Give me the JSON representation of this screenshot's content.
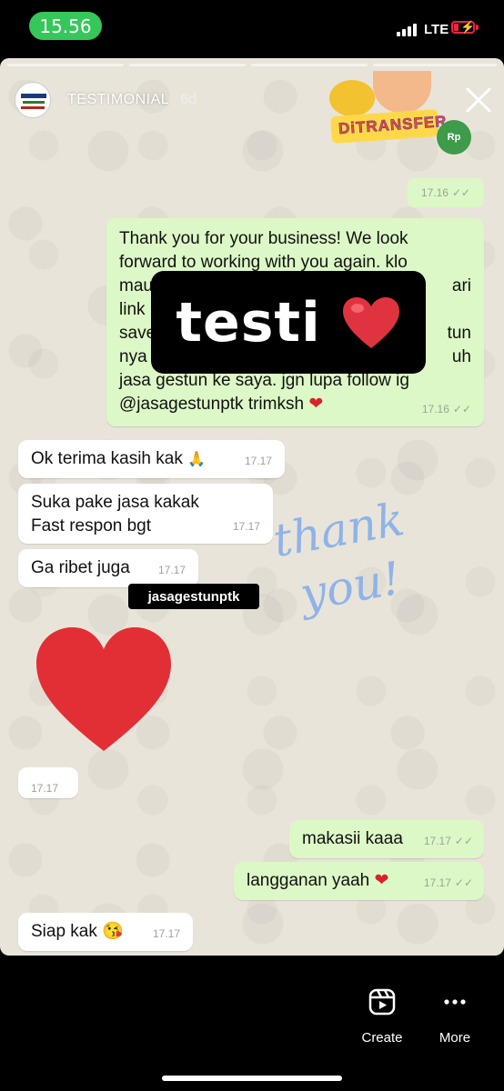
{
  "status_bar": {
    "time": "15.56",
    "network": "LTE",
    "colors": {
      "time_pill": "#35c759",
      "battery": "#ee2244"
    }
  },
  "story": {
    "account_name": "TESTIMONIAL",
    "age": "6d",
    "close_icon": "close-icon",
    "progress_segments": 4
  },
  "stickers": {
    "transfer_text": "DiTRANSFER",
    "money_text": "Rp",
    "testi_text": "testi",
    "testi_emoji": "heart",
    "mention": "jasagestunptk",
    "thank_line1": "thank",
    "thank_line2": "you!"
  },
  "chat": {
    "top_time": "17.16",
    "long_message": {
      "lines": [
        "Thank you for your business! We look",
        "forward to working with you again. klo",
        "mau",
        "link",
        "save",
        "nya",
        "jasa gestun ke saya. jgn lupa follow ig",
        "@jasagestunptk trimksh"
      ],
      "right_fragments": [
        "ari",
        "tun",
        "uh"
      ],
      "time": "17.16"
    },
    "incoming_1": {
      "text": "Ok terima kasih kak",
      "emoji": "pray",
      "time": "17.17"
    },
    "incoming_2": {
      "line1": "Suka pake jasa kakak",
      "line2": "Fast respon bgt",
      "time": "17.17"
    },
    "incoming_3": {
      "text": "Ga ribet juga",
      "time": "17.17"
    },
    "heart_time": "17.17",
    "outgoing_1": {
      "text": "makasii kaaa",
      "time": "17.17"
    },
    "outgoing_2": {
      "text": "langganan yaah",
      "time": "17.17"
    },
    "incoming_4": {
      "text": "Siap kak",
      "emoji": "kissing-face",
      "time": "17.17"
    },
    "colors": {
      "outgoing": "#dcf8c6",
      "incoming": "#ffffff",
      "wallpaper": "#e9e4da"
    }
  },
  "bottom_bar": {
    "create_label": "Create",
    "more_label": "More",
    "create_icon": "reels-create-icon",
    "more_icon": "more-dots-icon"
  }
}
